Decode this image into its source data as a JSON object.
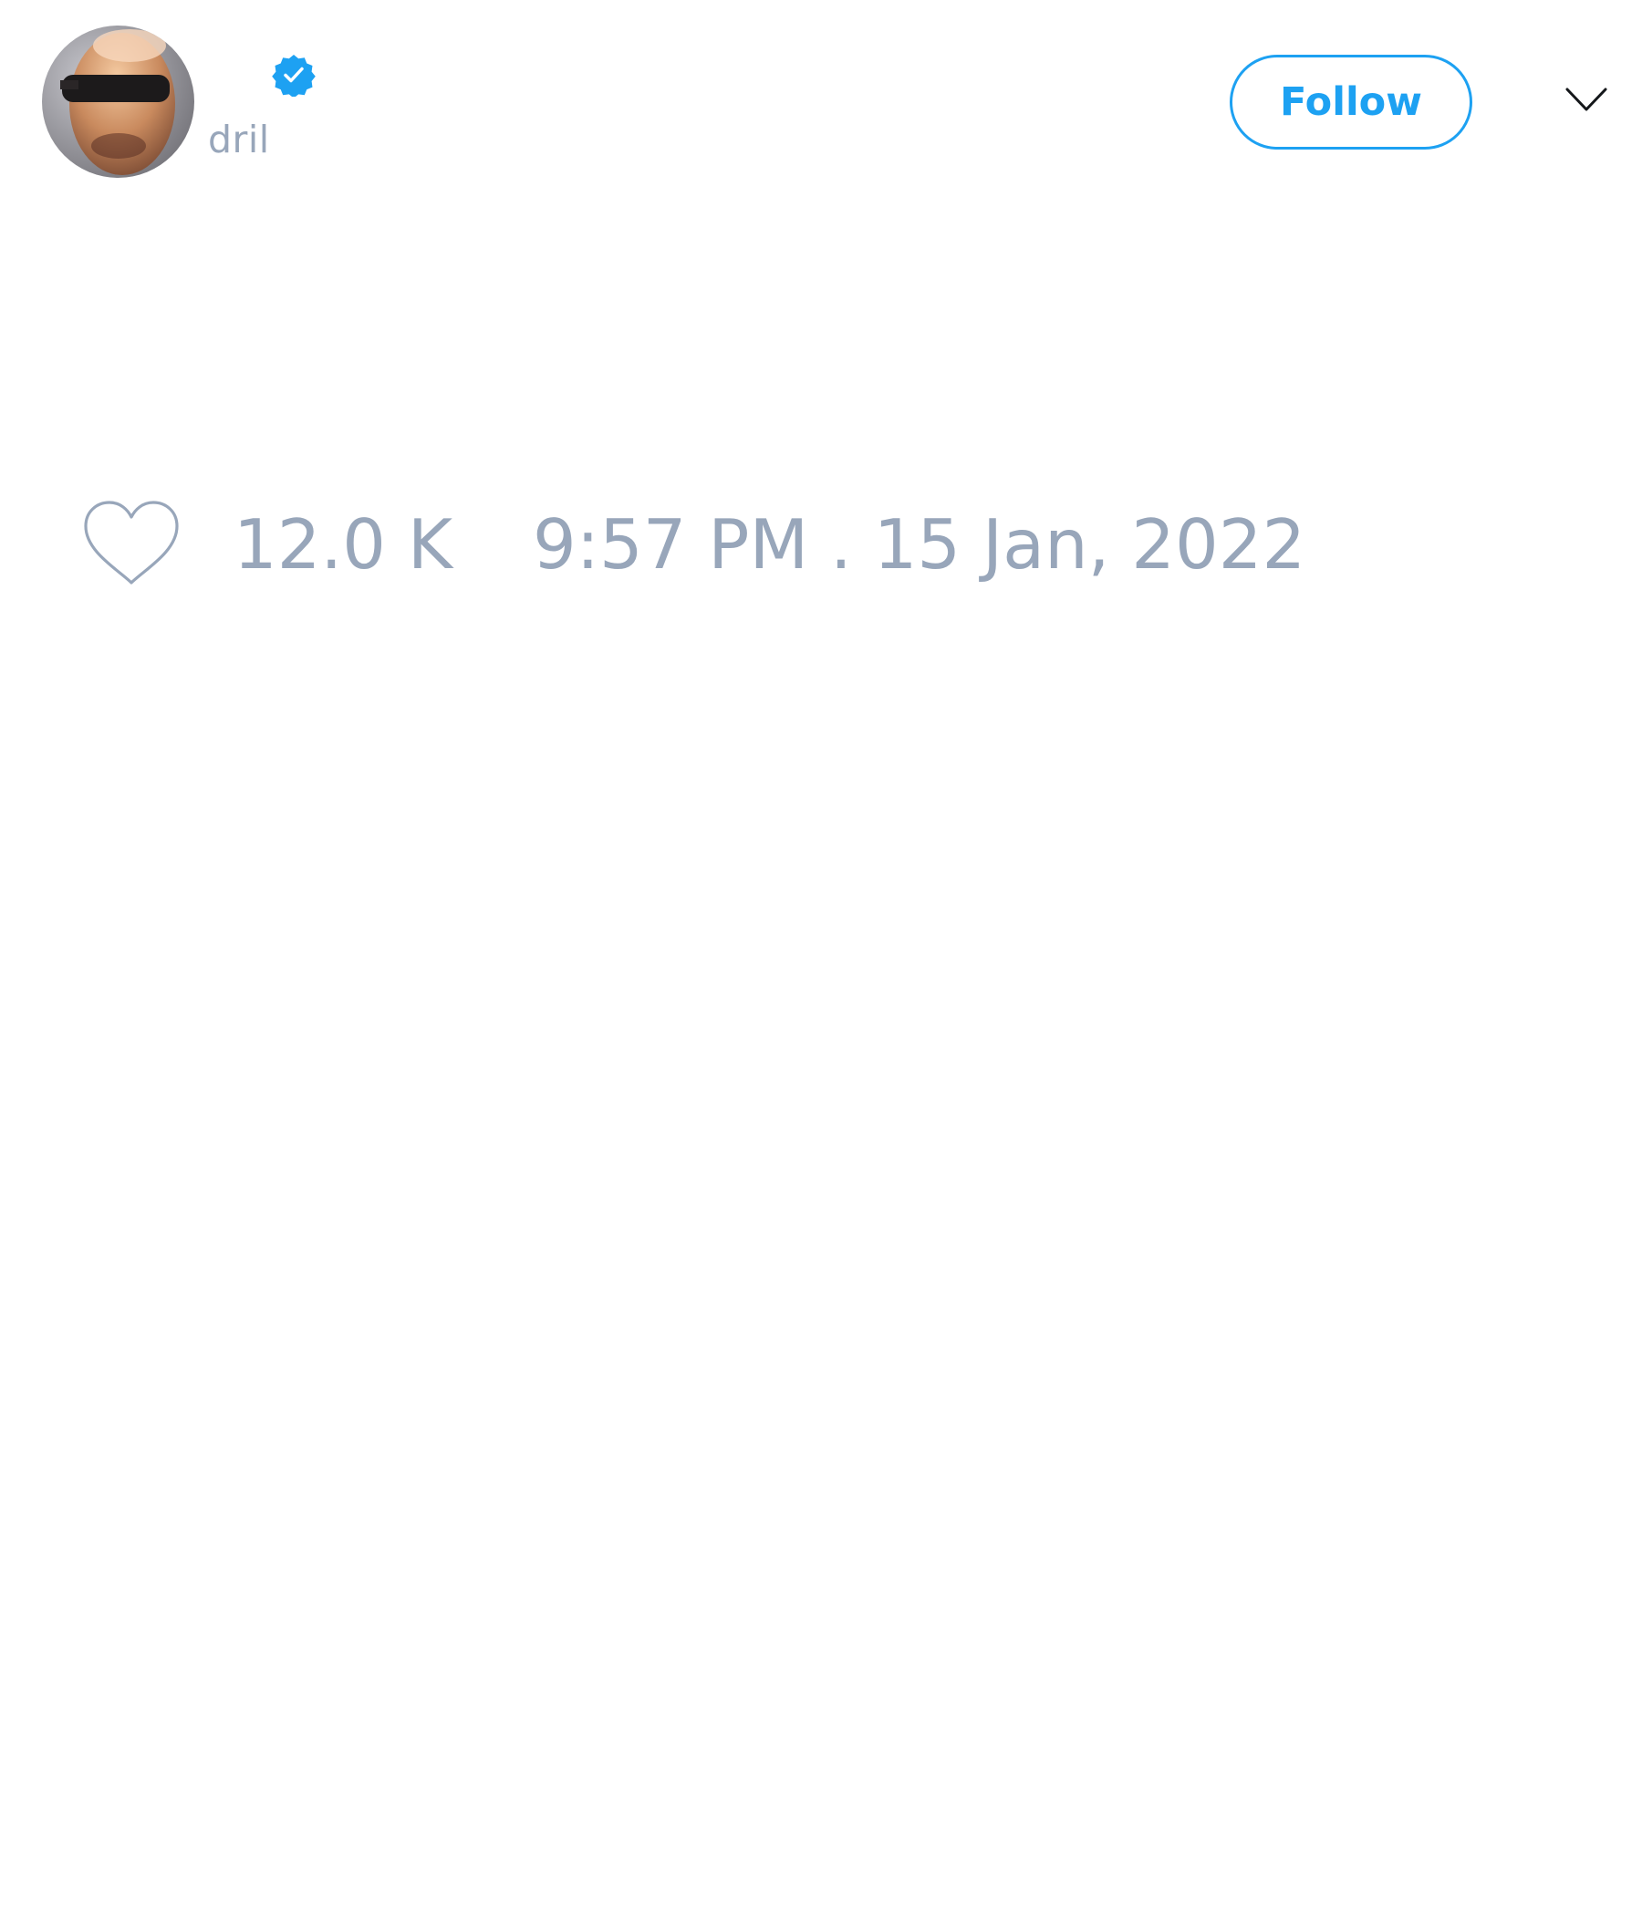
{
  "author": {
    "handle": "dril",
    "verified": true,
    "avatar_icon": "user-photo-avatar"
  },
  "actions": {
    "follow_label": "Follow",
    "menu_icon": "chevron-down-icon"
  },
  "stats": {
    "like_icon": "heart-outline-icon",
    "likes": "12.0 K"
  },
  "meta": {
    "timestamp": "9:57 PM . 15 Jan, 2022"
  },
  "colors": {
    "accent": "#1da1f2",
    "muted_text": "#98a6ba",
    "background": "#ffffff"
  }
}
